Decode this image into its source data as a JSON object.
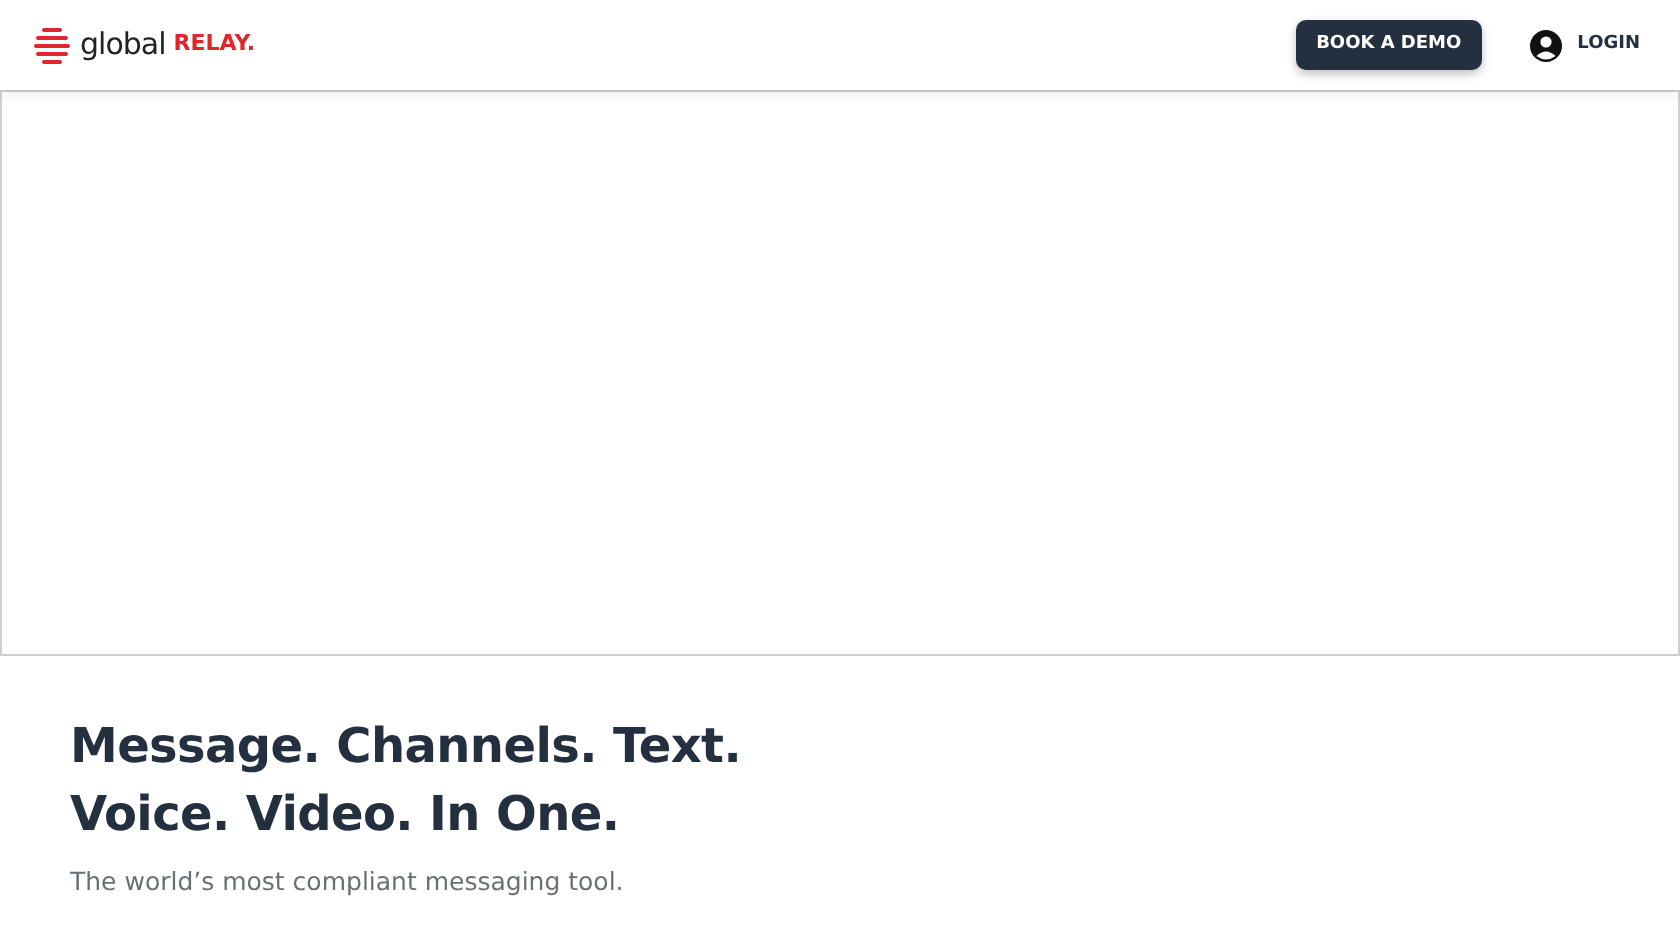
{
  "header": {
    "logo": {
      "word_1": "global",
      "word_2": "RELAY."
    },
    "buttons": [
      {
        "kind": "primary",
        "label": "BOOK A DEMO"
      },
      {
        "kind": "account",
        "label": "LOGIN"
      }
    ]
  },
  "hero": {
    "heading": "Message. Channels. Text. Voice. Video. In One.",
    "subtitle": "The world’s most compliant messaging tool."
  }
}
